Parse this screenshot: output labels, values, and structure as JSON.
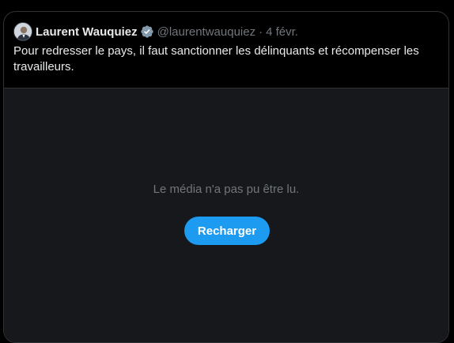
{
  "tweet": {
    "author_name": "Laurent Wauquiez",
    "handle": "@laurentwauquiez",
    "separator": "·",
    "date": "4 févr.",
    "text": "Pour redresser le pays, il faut sanctionner les délinquants et récompenser les travailleurs."
  },
  "media": {
    "error_message": "Le média n'a pas pu être lu.",
    "reload_label": "Recharger"
  },
  "icons": {
    "verified": "verified-badge-icon",
    "avatar": "avatar"
  },
  "colors": {
    "background": "#000000",
    "text_primary": "#e7e9ea",
    "text_secondary": "#71767b",
    "media_background": "#16181c",
    "accent": "#1d9bf0",
    "verified_badge": "#829aab"
  }
}
